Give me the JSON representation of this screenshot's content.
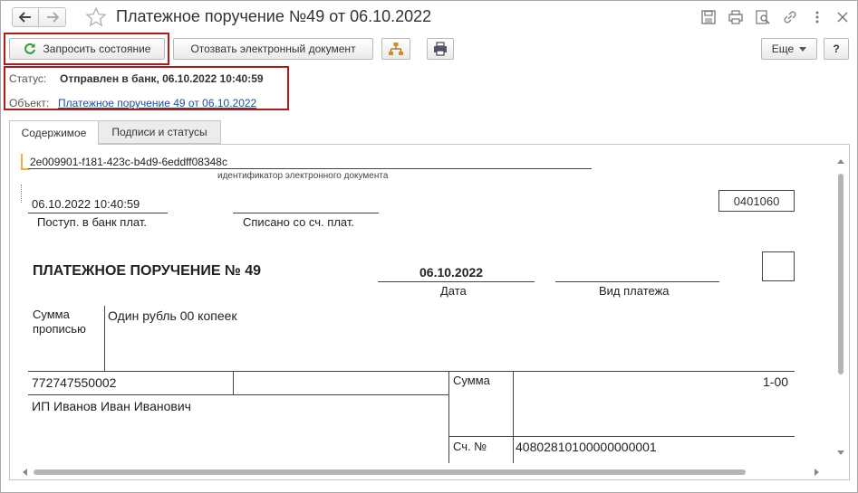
{
  "window": {
    "title": "Платежное поручение №49 от 06.10.2022"
  },
  "toolbar": {
    "request_status_label": "Запросить состояние",
    "recall_label": "Отозвать электронный документ",
    "more_label": "Еще",
    "help_label": "?"
  },
  "info": {
    "status_label": "Статус:",
    "status_value": "Отправлен в банк, 06.10.2022 10:40:59",
    "object_label": "Объект:",
    "object_link": "Платежное поручение 49 от 06.10.2022"
  },
  "tabs": [
    {
      "label": "Содержимое",
      "active": true
    },
    {
      "label": "Подписи и статусы",
      "active": false
    }
  ],
  "document": {
    "doc_id": "2e009901-f181-423c-b4d9-6eddff08348c",
    "doc_id_caption": "идентификатор электронного документа",
    "received_date": "06.10.2022 10:40:59",
    "received_caption": "Поступ. в банк плат.",
    "debited_caption": "Списано со сч. плат.",
    "form_code": "0401060",
    "heading": "ПЛАТЕЖНОЕ ПОРУЧЕНИЕ № 49",
    "date_value": "06.10.2022",
    "date_caption": "Дата",
    "payment_type_caption": "Вид платежа",
    "amount_words_label_1": "Сумма",
    "amount_words_label_2": "прописью",
    "amount_words": "Один рубль 00 копеек",
    "inn": "772747550002",
    "payer_name": "ИП Иванов Иван Иванович",
    "amount_label": "Сумма",
    "amount_value": "1-00",
    "account_label": "Сч. №",
    "account_value": "40802810100000000001"
  },
  "colors": {
    "highlight_frame": "#b11a1a",
    "link": "#1f4fa1",
    "refresh_icon": "#2e9a3a",
    "structure_icon": "#d98c1c"
  }
}
